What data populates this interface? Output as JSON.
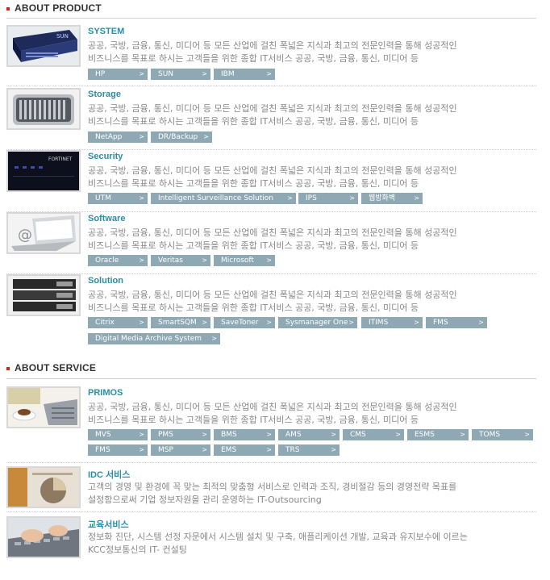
{
  "product": {
    "heading": "ABOUT PRODUCT",
    "items": [
      {
        "name": "SYSTEM",
        "desc": [
          "공공, 국방, 금융, 통신, 미디어 등 모든 산업에 걸친 폭넓은 지식과 최고의 전문인력을 통해 성공적인",
          "비즈니스를 목표로 하시는 고객들을 위한 종합 IT서비스 공공, 국방, 금융, 통신, 미디어 등"
        ],
        "tags": [
          "HP",
          "SUN",
          "IBM"
        ]
      },
      {
        "name": "Storage",
        "desc": [
          "공공, 국방, 금융, 통신, 미디어 등 모든 산업에 걸친 폭넓은 지식과 최고의 전문인력을 통해 성공적인",
          "비즈니스를 목표로 하시는 고객들을 위한 종합 IT서비스 공공, 국방, 금융, 통신, 미디어 등"
        ],
        "tags": [
          "NetApp",
          "DR/Backup"
        ]
      },
      {
        "name": "Security",
        "desc": [
          "공공, 국방, 금융, 통신, 미디어 등 모든 산업에 걸친 폭넓은 지식과 최고의 전문인력을 통해 성공적인",
          "비즈니스를 목표로 하시는 고객들을 위한 종합 IT서비스 공공, 국방, 금융, 통신, 미디어 등"
        ],
        "tags": [
          "UTM",
          "Intelligent Surveillance Solution",
          "IPS",
          "웹방화벽"
        ]
      },
      {
        "name": "Software",
        "desc": [
          "공공, 국방, 금융, 통신, 미디어 등 모든 산업에 걸친 폭넓은 지식과 최고의 전문인력을 통해 성공적인",
          "비즈니스를 목표로 하시는 고객들을 위한 종합 IT서비스 공공, 국방, 금융, 통신, 미디어 등"
        ],
        "tags": [
          "Oracle",
          "Veritas",
          "Microsoft"
        ]
      },
      {
        "name": "Solution",
        "desc": [
          "공공, 국방, 금융, 통신, 미디어 등 모든 산업에 걸친 폭넓은 지식과 최고의 전문인력을 통해 성공적인",
          "비즈니스를 목표로 하시는 고객들을 위한 종합 IT서비스 공공, 국방, 금융, 통신, 미디어 등"
        ],
        "tags": [
          "Citrix",
          "SmartSQM",
          "SaveToner",
          "Sysmanager One",
          "ITIMS",
          "FMS",
          "Digital Media Archive System"
        ]
      }
    ]
  },
  "service": {
    "heading": "ABOUT SERVICE",
    "items": [
      {
        "name": "PRIMOS",
        "desc": [
          "공공, 국방, 금융, 통신, 미디어 등 모든 산업에 걸친 폭넓은 지식과 최고의 전문인력을 통해 성공적인",
          "비즈니스를 목표로 하시는 고객들을 위한 종합 IT서비스 공공, 국방, 금융, 통신, 미디어 등"
        ],
        "tags": [
          "MVS",
          "PMS",
          "BMS",
          "AMS",
          "CMS",
          "ESMS",
          "TOMS",
          "FMS",
          "MSP",
          "EMS",
          "TRS"
        ]
      },
      {
        "name": "IDC 서비스",
        "desc": [
          "고객의 경영 및 환경에 꼭 맞는 최적의 맞춤형 서비스로 인력과 조직, 경비절감 등의 경영전략 목표를",
          "설정함으로써 기업 정보자원을 관리 운영하는 IT-Outsourcing"
        ],
        "tags": []
      },
      {
        "name": "교육서비스",
        "desc": [
          "정보화 진단, 시스템 선정 자문에서 시스템 설치 및 구축, 애플리케이션 개발, 교육과 유지보수에 이르는",
          "KCC정보통신의 IT- 컨설팅"
        ],
        "tags": []
      }
    ]
  },
  "tag_arrow": ">",
  "colors": {
    "accent": "#2a8fa6",
    "tag_bg": "#8fa9b4",
    "bullet": "#c8281e"
  },
  "icons": [
    "server-rack-icon",
    "storage-array-icon",
    "firewall-appliance-icon",
    "laptop-at-icon",
    "blade-server-icon",
    "coffee-laptop-icon",
    "chart-photo-icon",
    "keyboard-hands-icon"
  ]
}
